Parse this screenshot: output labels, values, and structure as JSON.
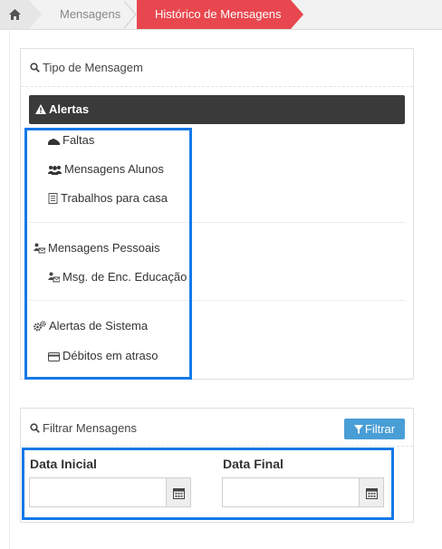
{
  "breadcrumb": {
    "home_icon": "home-icon",
    "items": [
      {
        "label": "Mensagens"
      },
      {
        "label": "Histórico de Mensagens"
      }
    ],
    "active_color": "#e8474f"
  },
  "tipo_panel": {
    "title": "Tipo de Mensagem",
    "icon": "search-icon",
    "alertas": {
      "label": "Alertas",
      "icon": "warning-icon"
    },
    "items": [
      {
        "label": "Faltas",
        "icon": "shoe-icon"
      },
      {
        "label": "Mensagens Alunos",
        "icon": "users-icon"
      },
      {
        "label": "Trabalhos para casa",
        "icon": "notebook-icon"
      },
      {
        "label": "Mensagens Pessoais",
        "icon": "person-letter-icon"
      },
      {
        "label": "Msg. de Enc. Educação",
        "icon": "person-letter-icon"
      },
      {
        "label": "Alertas de Sistema",
        "icon": "gears-icon"
      },
      {
        "label": "Débitos em atraso",
        "icon": "credit-card-icon"
      }
    ]
  },
  "filter_panel": {
    "title": "Filtrar Mensagens",
    "icon": "search-icon",
    "filter_button": "Filtrar",
    "data_inicial": {
      "label": "Data Inicial",
      "value": ""
    },
    "data_final": {
      "label": "Data Final",
      "value": ""
    }
  },
  "colors": {
    "highlight": "#1479e8",
    "filter_button": "#4a9ed6",
    "alert_bar": "#3a3a3a"
  }
}
